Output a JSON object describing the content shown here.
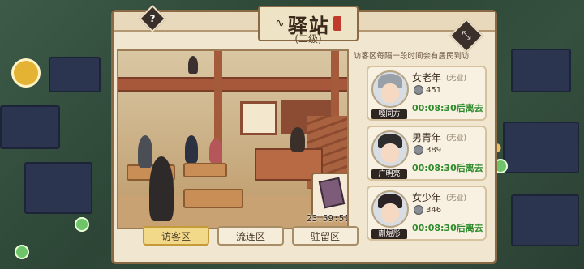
{
  "window": {
    "title": "驿站",
    "subtitle": "(二级)",
    "help_icon": "?",
    "close_icon": "⤡"
  },
  "scene": {
    "item_timer": "23:59:51"
  },
  "notice": "访客区每隔一段时间会有居民到访",
  "visitors": [
    {
      "type": "女老年",
      "job": "(无业)",
      "name": "嘎同方",
      "coins": "451",
      "leave_time": "00:08:30后离去",
      "hair_color": "#9aa0a8"
    },
    {
      "type": "男青年",
      "job": "(无业)",
      "name": "广明亮",
      "coins": "389",
      "leave_time": "00:08:30后离去",
      "hair_color": "#2d2d2d"
    },
    {
      "type": "女少年",
      "job": "(无业)",
      "name": "蒯煜彤",
      "coins": "346",
      "leave_time": "00:08:30后离去",
      "hair_color": "#2a2224"
    }
  ],
  "tabs": [
    {
      "label": "访客区",
      "active": true
    },
    {
      "label": "流连区",
      "active": false
    },
    {
      "label": "驻留区",
      "active": false
    }
  ],
  "colors": {
    "leave_text": "#2e8a2a",
    "active_tab": "#f2d98a"
  }
}
